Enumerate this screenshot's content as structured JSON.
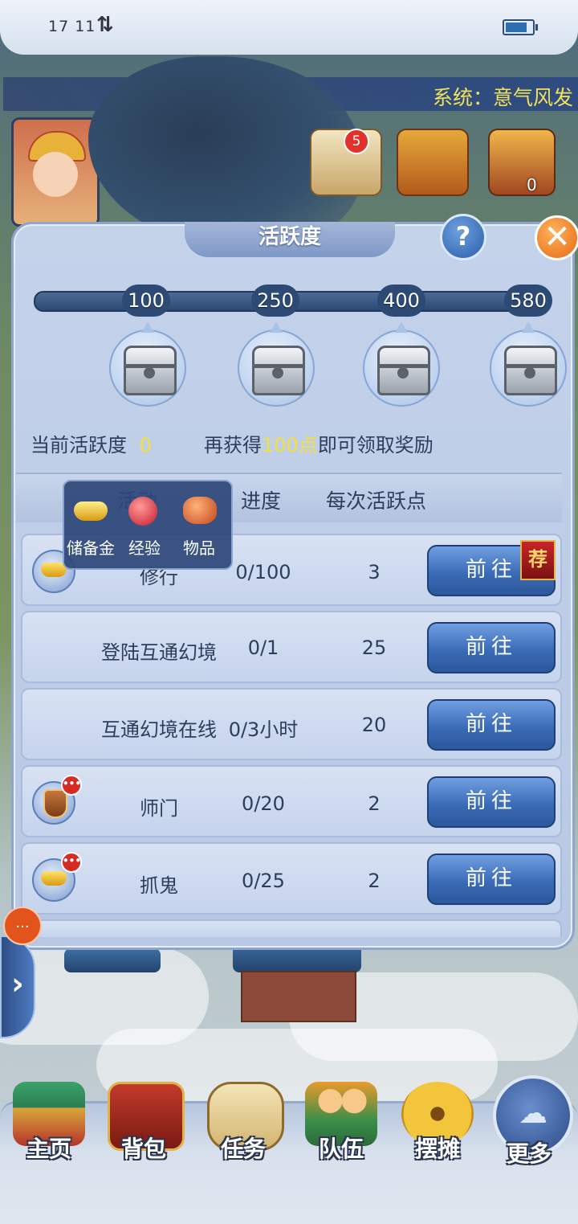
{
  "status_bar": {
    "time": "17 11",
    "data_arrows": "⇅"
  },
  "system_ticker": "系统：意气风发",
  "hud": {
    "quest_scroll_badge": "5",
    "torch_count": "0"
  },
  "panel": {
    "title": "活跃度",
    "help_label": "?",
    "close_label": "✕",
    "milestones": [
      "100",
      "250",
      "400",
      "580"
    ],
    "current_label": "当前活跃度",
    "current_value": "0",
    "hint_prefix": "再获得",
    "hint_highlight": "100点",
    "hint_suffix": "即可领取奖励",
    "columns": {
      "activity": "活动",
      "progress": "进度",
      "points": "每次活跃点"
    },
    "tooltip": {
      "items": [
        "储备金",
        "经验",
        "物品"
      ]
    },
    "recommend_badge": "荐",
    "rows": [
      {
        "name": "修行",
        "progress": "0/100",
        "points": "3",
        "button": "前往"
      },
      {
        "name": "登陆互通幻境",
        "progress": "0/1",
        "points": "25",
        "button": "前往"
      },
      {
        "name": "互通幻境在线",
        "progress": "0/3小时",
        "points": "20",
        "button": "前往"
      },
      {
        "name": "师门",
        "progress": "0/20",
        "points": "2",
        "button": "前往"
      },
      {
        "name": "抓鬼",
        "progress": "0/25",
        "points": "2",
        "button": "前往"
      }
    ]
  },
  "side": {
    "more_dots": "...",
    "expand_arrow": "›"
  },
  "bottom_nav": [
    "主页",
    "背包",
    "任务",
    "队伍",
    "摆摊",
    "更多"
  ]
}
